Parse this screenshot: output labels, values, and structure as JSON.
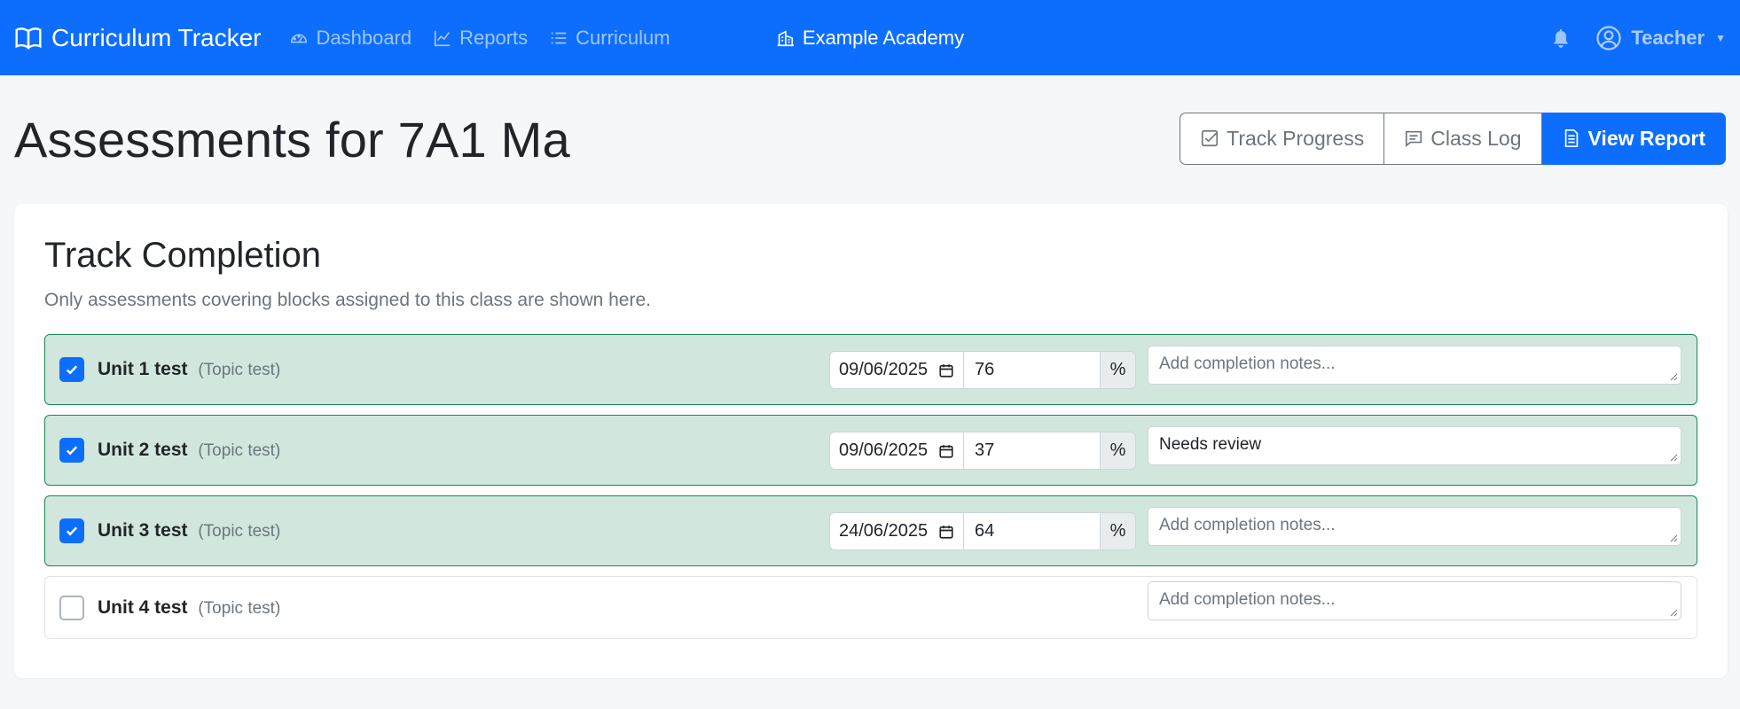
{
  "navbar": {
    "brand": "Curriculum Tracker",
    "links": [
      {
        "label": "Dashboard",
        "icon": "speedometer-icon"
      },
      {
        "label": "Reports",
        "icon": "graph-icon"
      },
      {
        "label": "Curriculum",
        "icon": "list-icon"
      }
    ],
    "school": "Example Academy",
    "user": "Teacher",
    "bg_color": "#0d6efd"
  },
  "page": {
    "title": "Assessments for 7A1 Ma",
    "actions": [
      {
        "label": "Track Progress",
        "icon": "check-square-icon"
      },
      {
        "label": "Class Log",
        "icon": "chat-icon"
      },
      {
        "label": "View Report",
        "icon": "document-icon",
        "primary": true
      }
    ]
  },
  "card": {
    "title": "Track Completion",
    "subtitle": "Only assessments covering blocks assigned to this class are shown here.",
    "notes_placeholder": "Add completion notes...",
    "assessments": [
      {
        "name": "Unit 1 test",
        "type": "(Topic test)",
        "completed": true,
        "date": "09/06/2025",
        "score": "76",
        "unit": "%",
        "notes": ""
      },
      {
        "name": "Unit 2 test",
        "type": "(Topic test)",
        "completed": true,
        "date": "09/06/2025",
        "score": "37",
        "unit": "%",
        "notes": "Needs review"
      },
      {
        "name": "Unit 3 test",
        "type": "(Topic test)",
        "completed": true,
        "date": "24/06/2025",
        "score": "64",
        "unit": "%",
        "notes": ""
      },
      {
        "name": "Unit 4 test",
        "type": "(Topic test)",
        "completed": false,
        "date": "",
        "score": "",
        "unit": "",
        "notes": ""
      }
    ]
  },
  "colors": {
    "success_bg": "#d1e7dd",
    "success_border": "#198754",
    "primary": "#0d6efd"
  }
}
